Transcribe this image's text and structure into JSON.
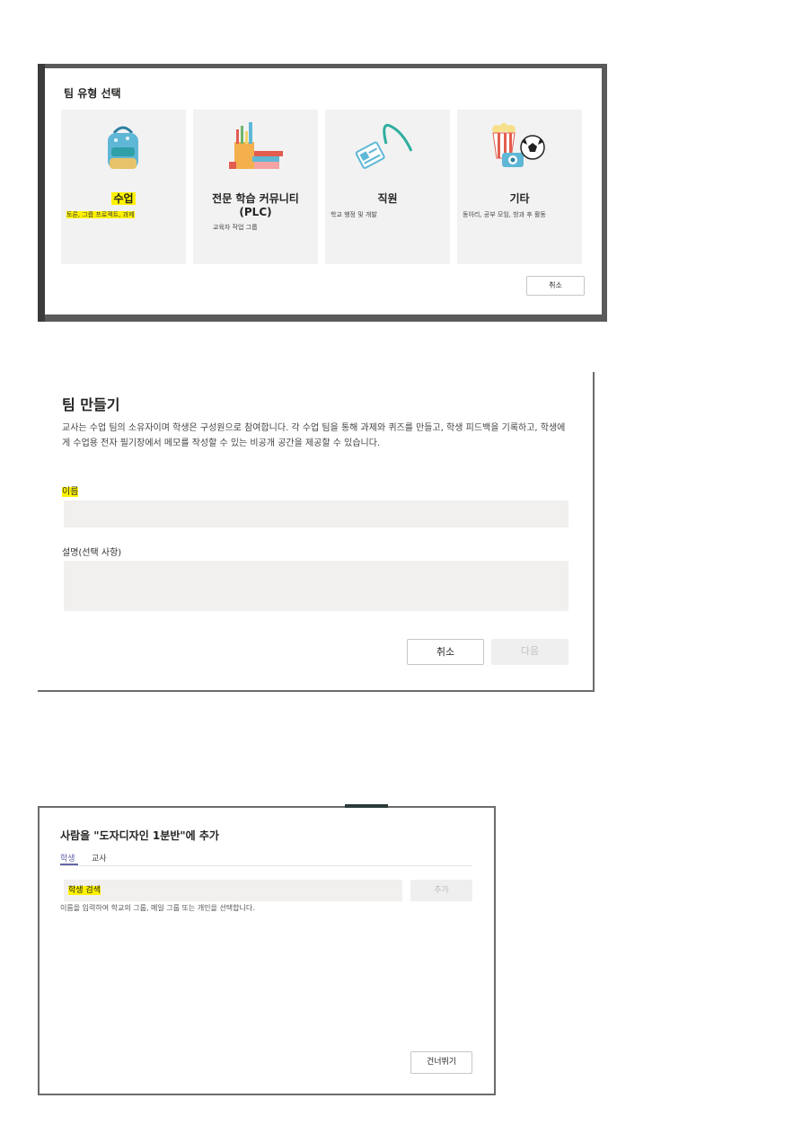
{
  "panel1": {
    "title": "팀 유형 선택",
    "cards": [
      {
        "name": "수업",
        "desc": "토론, 그룹 프로젝트, 과제",
        "icon": "backpack-icon"
      },
      {
        "name_line1": "전문 학습 커뮤니티",
        "name_line2": "(PLC)",
        "desc": "교육자 작업 그룹",
        "icon": "books-pencils-icon"
      },
      {
        "name": "직원",
        "desc": "학교 행정 및 개발",
        "icon": "id-badge-icon"
      },
      {
        "name": "기타",
        "desc": "동아리, 공부 모임, 방과 후 활동",
        "icon": "popcorn-camera-ball-icon"
      }
    ],
    "cancel_label": "취소"
  },
  "panel2": {
    "title": "팀 만들기",
    "description": "교사는 수업 팀의 소유자이며 학생은 구성원으로 참여합니다. 각 수업 팀을 통해 과제와 퀴즈를 만들고, 학생 피드백을 기록하고, 학생에게 수업용 전자 필기장에서 메모를 작성할 수 있는 비공개 공간을 제공할 수 있습니다.",
    "name_label": "이름",
    "desc_label": "설명(선택 사항)",
    "cancel_label": "취소",
    "next_label": "다음"
  },
  "panel3": {
    "title": "사람을 \"도자디자인 1분반\"에 추가",
    "tabs": [
      "학생",
      "교사"
    ],
    "search_placeholder": "학생 검색",
    "add_label": "추가",
    "help": "이름을 입력하여 학교의 그룹, 메일 그룹 또는 개인을 선택합니다.",
    "skip_label": "건너뛰기"
  },
  "colors": {
    "highlight": "#fff200",
    "accent": "#6264a7",
    "field_bg": "#f2f0ee",
    "card_bg": "#f2f2f2"
  }
}
